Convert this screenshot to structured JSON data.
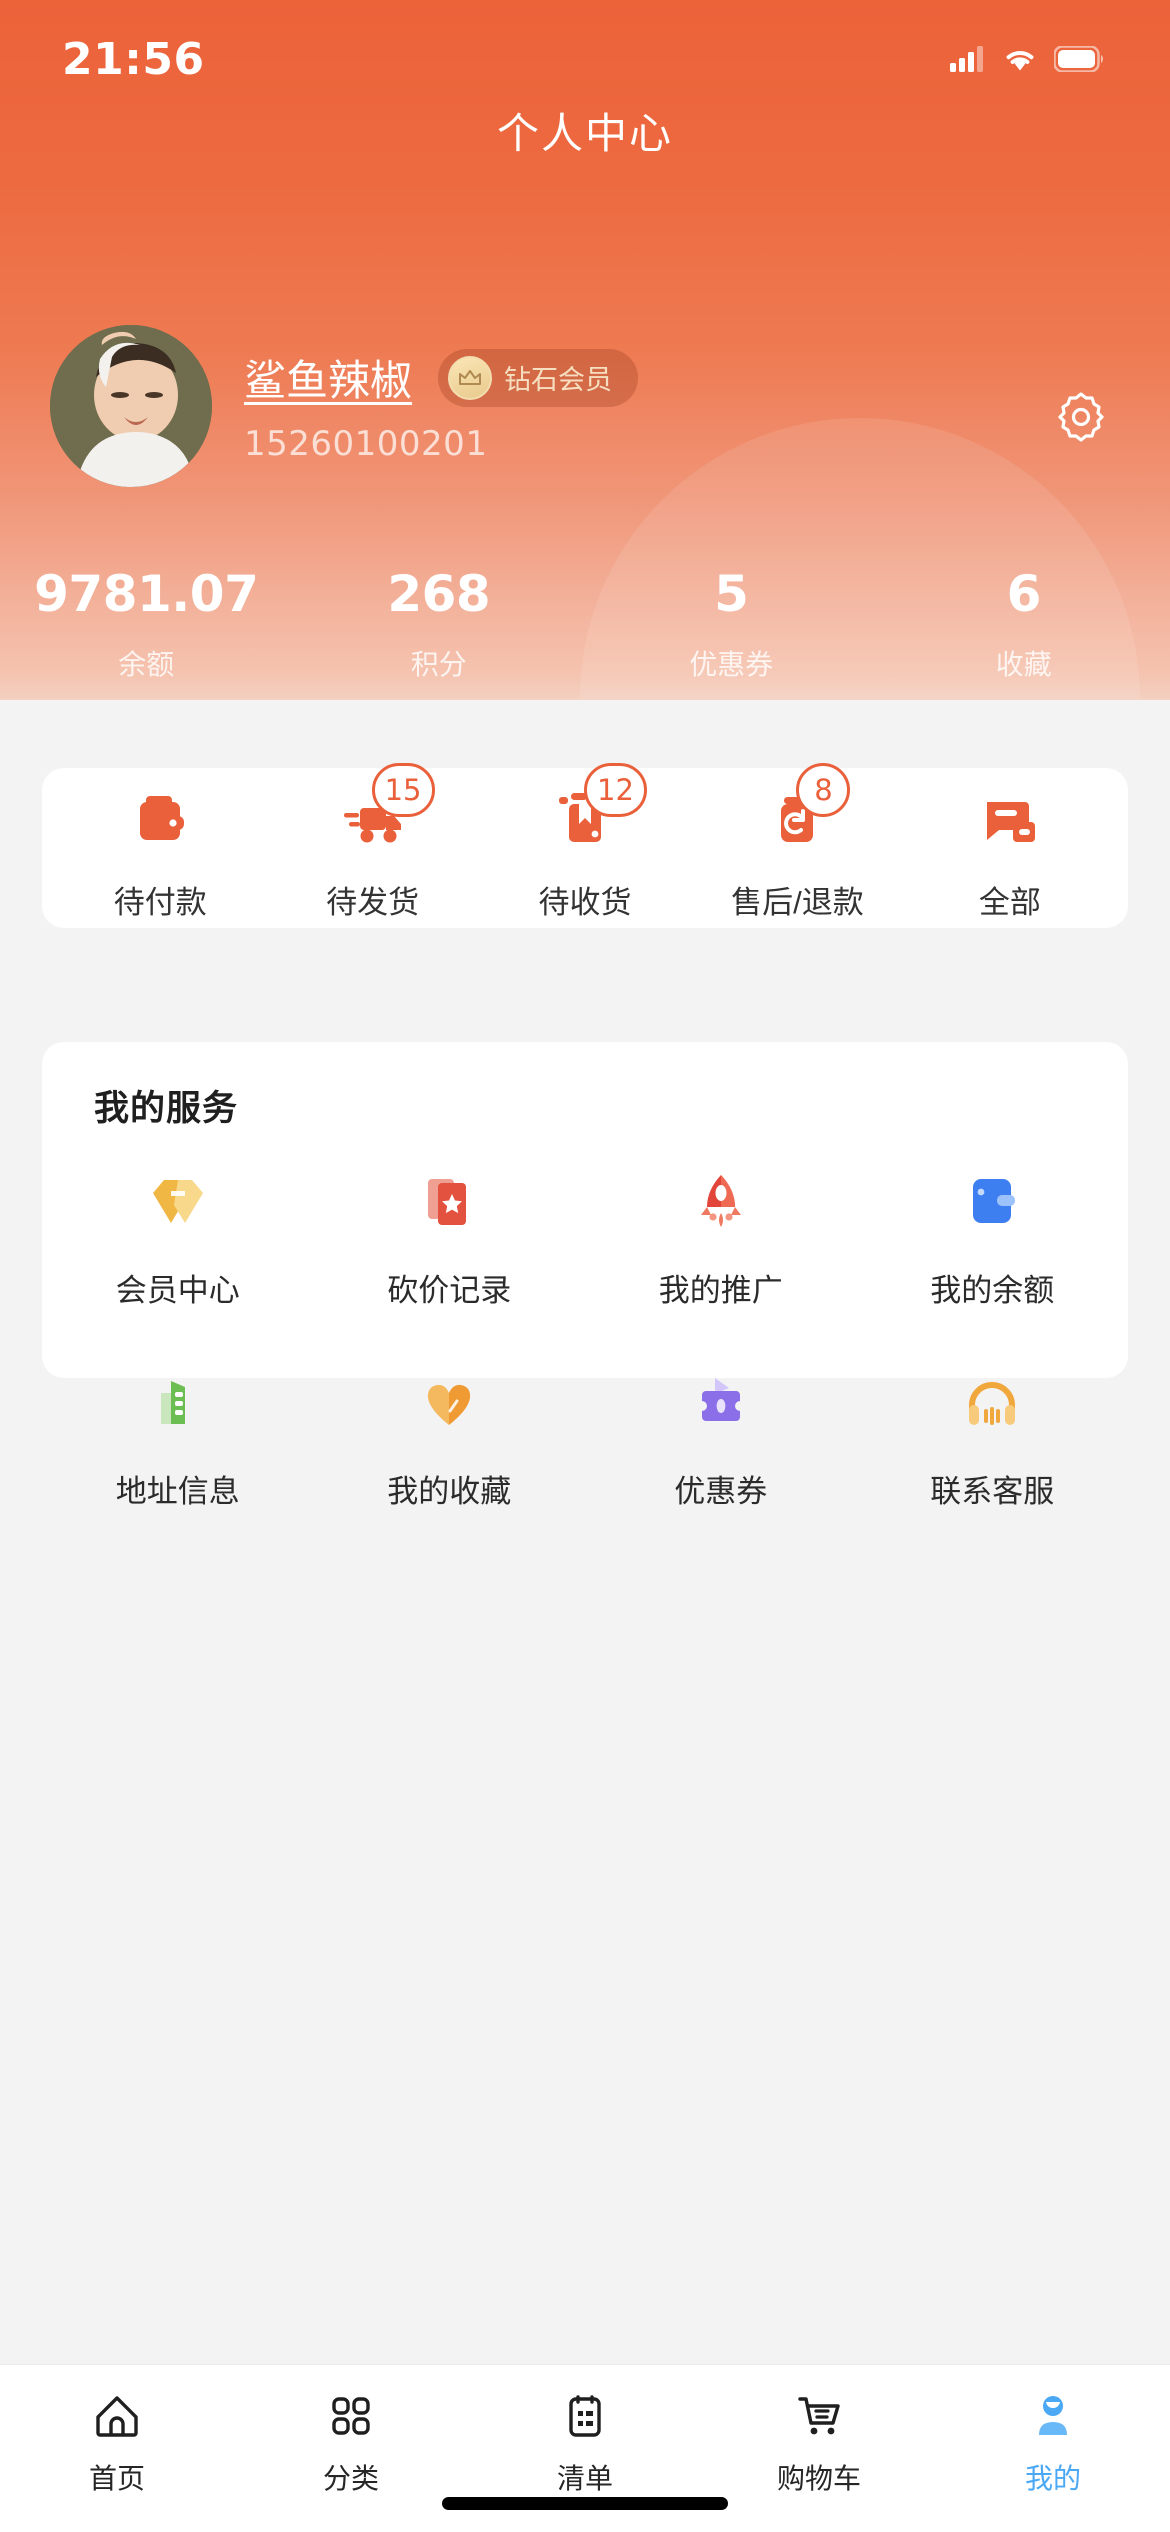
{
  "status_bar": {
    "time": "21:56",
    "signal_icon": "cellular-signal-icon",
    "wifi_icon": "wifi-icon",
    "battery_icon": "battery-icon"
  },
  "header": {
    "title": "个人中心",
    "gear_icon": "gear-icon",
    "accent_color": "#ec6239",
    "profile": {
      "avatar_icon": "user-avatar-photo",
      "name": "鲨鱼辣椒",
      "phone": "15260100201",
      "vip_badge": {
        "label": "钻石会员",
        "icon": "crown-icon"
      }
    },
    "stats": [
      {
        "value": "9781.07",
        "label": "余额"
      },
      {
        "value": "268",
        "label": "积分"
      },
      {
        "value": "5",
        "label": "优惠券"
      },
      {
        "value": "6",
        "label": "收藏"
      }
    ]
  },
  "order_status": {
    "items": [
      {
        "label": "待付款",
        "icon": "wallet-icon",
        "badge": ""
      },
      {
        "label": "待发货",
        "icon": "delivery-truck-icon",
        "badge": "15"
      },
      {
        "label": "待收货",
        "icon": "package-box-icon",
        "badge": "12"
      },
      {
        "label": "售后/退款",
        "icon": "refund-icon",
        "badge": "8"
      },
      {
        "label": "全部",
        "icon": "all-orders-icon",
        "badge": ""
      }
    ]
  },
  "services": {
    "title": "我的服务",
    "items": [
      {
        "label": "会员中心",
        "icon": "membership-tag-icon",
        "color": "#f5b942"
      },
      {
        "label": "砍价记录",
        "icon": "bargain-card-star-icon",
        "color": "#e8513f"
      },
      {
        "label": "我的推广",
        "icon": "rocket-icon",
        "color": "#e8443a"
      },
      {
        "label": "我的余额",
        "icon": "blue-wallet-icon",
        "color": "#3d7ef0"
      },
      {
        "label": "地址信息",
        "icon": "address-building-icon",
        "color": "#6cbe52"
      },
      {
        "label": "我的收藏",
        "icon": "heart-icon",
        "color": "#f2a23c"
      },
      {
        "label": "优惠券",
        "icon": "coupon-ticket-icon",
        "color": "#8a6fe8"
      },
      {
        "label": "联系客服",
        "icon": "headset-icon",
        "color": "#f0a73c"
      }
    ]
  },
  "tabbar": {
    "active_color": "#4aa8f5",
    "items": [
      {
        "label": "首页",
        "icon": "home-icon",
        "active": false
      },
      {
        "label": "分类",
        "icon": "grid-category-icon",
        "active": false
      },
      {
        "label": "清单",
        "icon": "clipboard-list-icon",
        "active": false
      },
      {
        "label": "购物车",
        "icon": "shopping-cart-icon",
        "active": false
      },
      {
        "label": "我的",
        "icon": "person-icon",
        "active": true
      }
    ]
  }
}
